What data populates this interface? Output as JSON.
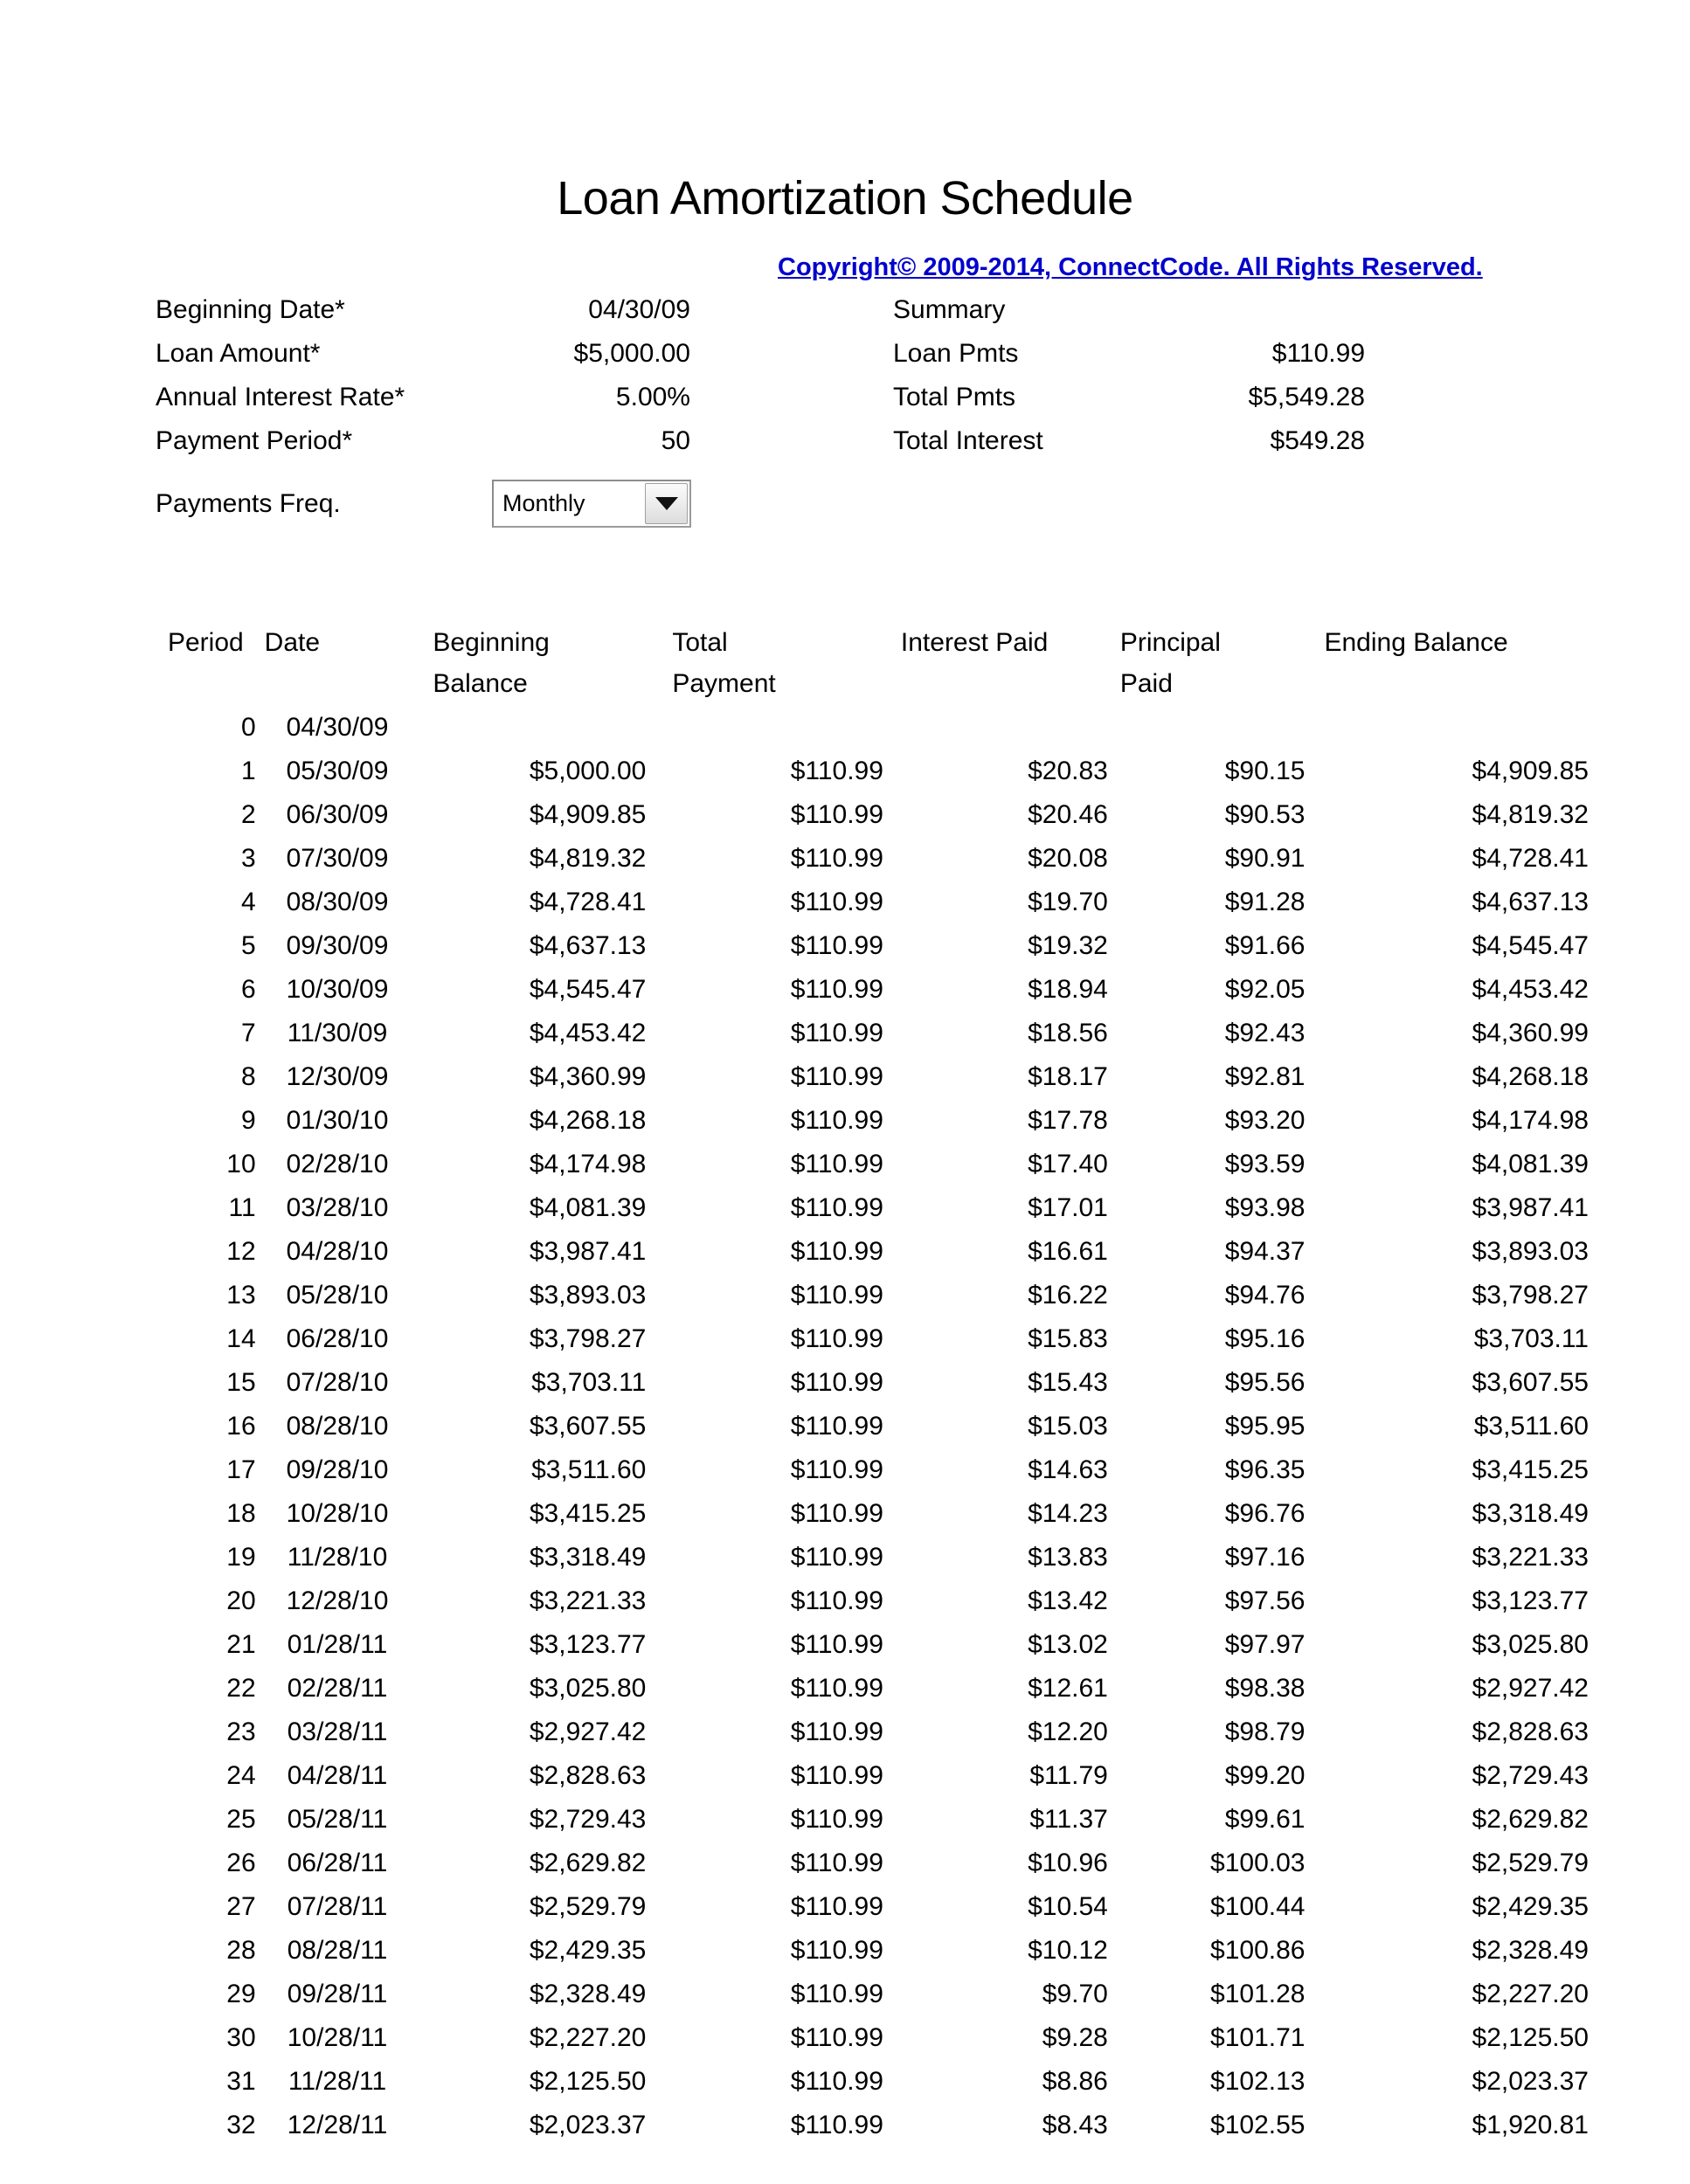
{
  "title": "Loan Amortization Schedule",
  "copyright": "Copyright© 2009-2014, ConnectCode. All Rights Reserved.",
  "colors": {
    "link": "#0000CC",
    "text": "#000000",
    "background": "#FFFFFF"
  },
  "inputs": {
    "rows": [
      {
        "label": "Beginning Date*",
        "value": "04/30/09"
      },
      {
        "label": "Loan Amount*",
        "value": "$5,000.00"
      },
      {
        "label": "Annual Interest Rate*",
        "value": "5.00%"
      },
      {
        "label": "Payment Period*",
        "value": "50"
      }
    ],
    "frequency": {
      "label": "Payments Freq.",
      "selected": "Monthly"
    }
  },
  "summary": {
    "heading": "Summary",
    "rows": [
      {
        "label": "Loan Pmts",
        "value": "$110.99"
      },
      {
        "label": "Total Pmts",
        "value": "$5,549.28"
      },
      {
        "label": "Total Interest",
        "value": "$549.28"
      }
    ]
  },
  "schedule": {
    "headers": [
      {
        "line1": "Period",
        "line2": ""
      },
      {
        "line1": "Date",
        "line2": ""
      },
      {
        "line1": "Beginning",
        "line2": "Balance"
      },
      {
        "line1": "Total",
        "line2": "Payment"
      },
      {
        "line1": "Interest Paid",
        "line2": ""
      },
      {
        "line1": "Principal",
        "line2": "Paid"
      },
      {
        "line1": "Ending Balance",
        "line2": ""
      }
    ],
    "rows": [
      {
        "period": "0",
        "date": "04/30/09",
        "beginning": "",
        "payment": "",
        "interest": "",
        "principal": "",
        "ending": ""
      },
      {
        "period": "1",
        "date": "05/30/09",
        "beginning": "$5,000.00",
        "payment": "$110.99",
        "interest": "$20.83",
        "principal": "$90.15",
        "ending": "$4,909.85"
      },
      {
        "period": "2",
        "date": "06/30/09",
        "beginning": "$4,909.85",
        "payment": "$110.99",
        "interest": "$20.46",
        "principal": "$90.53",
        "ending": "$4,819.32"
      },
      {
        "period": "3",
        "date": "07/30/09",
        "beginning": "$4,819.32",
        "payment": "$110.99",
        "interest": "$20.08",
        "principal": "$90.91",
        "ending": "$4,728.41"
      },
      {
        "period": "4",
        "date": "08/30/09",
        "beginning": "$4,728.41",
        "payment": "$110.99",
        "interest": "$19.70",
        "principal": "$91.28",
        "ending": "$4,637.13"
      },
      {
        "period": "5",
        "date": "09/30/09",
        "beginning": "$4,637.13",
        "payment": "$110.99",
        "interest": "$19.32",
        "principal": "$91.66",
        "ending": "$4,545.47"
      },
      {
        "period": "6",
        "date": "10/30/09",
        "beginning": "$4,545.47",
        "payment": "$110.99",
        "interest": "$18.94",
        "principal": "$92.05",
        "ending": "$4,453.42"
      },
      {
        "period": "7",
        "date": "11/30/09",
        "beginning": "$4,453.42",
        "payment": "$110.99",
        "interest": "$18.56",
        "principal": "$92.43",
        "ending": "$4,360.99"
      },
      {
        "period": "8",
        "date": "12/30/09",
        "beginning": "$4,360.99",
        "payment": "$110.99",
        "interest": "$18.17",
        "principal": "$92.81",
        "ending": "$4,268.18"
      },
      {
        "period": "9",
        "date": "01/30/10",
        "beginning": "$4,268.18",
        "payment": "$110.99",
        "interest": "$17.78",
        "principal": "$93.20",
        "ending": "$4,174.98"
      },
      {
        "period": "10",
        "date": "02/28/10",
        "beginning": "$4,174.98",
        "payment": "$110.99",
        "interest": "$17.40",
        "principal": "$93.59",
        "ending": "$4,081.39"
      },
      {
        "period": "11",
        "date": "03/28/10",
        "beginning": "$4,081.39",
        "payment": "$110.99",
        "interest": "$17.01",
        "principal": "$93.98",
        "ending": "$3,987.41"
      },
      {
        "period": "12",
        "date": "04/28/10",
        "beginning": "$3,987.41",
        "payment": "$110.99",
        "interest": "$16.61",
        "principal": "$94.37",
        "ending": "$3,893.03"
      },
      {
        "period": "13",
        "date": "05/28/10",
        "beginning": "$3,893.03",
        "payment": "$110.99",
        "interest": "$16.22",
        "principal": "$94.76",
        "ending": "$3,798.27"
      },
      {
        "period": "14",
        "date": "06/28/10",
        "beginning": "$3,798.27",
        "payment": "$110.99",
        "interest": "$15.83",
        "principal": "$95.16",
        "ending": "$3,703.11"
      },
      {
        "period": "15",
        "date": "07/28/10",
        "beginning": "$3,703.11",
        "payment": "$110.99",
        "interest": "$15.43",
        "principal": "$95.56",
        "ending": "$3,607.55"
      },
      {
        "period": "16",
        "date": "08/28/10",
        "beginning": "$3,607.55",
        "payment": "$110.99",
        "interest": "$15.03",
        "principal": "$95.95",
        "ending": "$3,511.60"
      },
      {
        "period": "17",
        "date": "09/28/10",
        "beginning": "$3,511.60",
        "payment": "$110.99",
        "interest": "$14.63",
        "principal": "$96.35",
        "ending": "$3,415.25"
      },
      {
        "period": "18",
        "date": "10/28/10",
        "beginning": "$3,415.25",
        "payment": "$110.99",
        "interest": "$14.23",
        "principal": "$96.76",
        "ending": "$3,318.49"
      },
      {
        "period": "19",
        "date": "11/28/10",
        "beginning": "$3,318.49",
        "payment": "$110.99",
        "interest": "$13.83",
        "principal": "$97.16",
        "ending": "$3,221.33"
      },
      {
        "period": "20",
        "date": "12/28/10",
        "beginning": "$3,221.33",
        "payment": "$110.99",
        "interest": "$13.42",
        "principal": "$97.56",
        "ending": "$3,123.77"
      },
      {
        "period": "21",
        "date": "01/28/11",
        "beginning": "$3,123.77",
        "payment": "$110.99",
        "interest": "$13.02",
        "principal": "$97.97",
        "ending": "$3,025.80"
      },
      {
        "period": "22",
        "date": "02/28/11",
        "beginning": "$3,025.80",
        "payment": "$110.99",
        "interest": "$12.61",
        "principal": "$98.38",
        "ending": "$2,927.42"
      },
      {
        "period": "23",
        "date": "03/28/11",
        "beginning": "$2,927.42",
        "payment": "$110.99",
        "interest": "$12.20",
        "principal": "$98.79",
        "ending": "$2,828.63"
      },
      {
        "period": "24",
        "date": "04/28/11",
        "beginning": "$2,828.63",
        "payment": "$110.99",
        "interest": "$11.79",
        "principal": "$99.20",
        "ending": "$2,729.43"
      },
      {
        "period": "25",
        "date": "05/28/11",
        "beginning": "$2,729.43",
        "payment": "$110.99",
        "interest": "$11.37",
        "principal": "$99.61",
        "ending": "$2,629.82"
      },
      {
        "period": "26",
        "date": "06/28/11",
        "beginning": "$2,629.82",
        "payment": "$110.99",
        "interest": "$10.96",
        "principal": "$100.03",
        "ending": "$2,529.79"
      },
      {
        "period": "27",
        "date": "07/28/11",
        "beginning": "$2,529.79",
        "payment": "$110.99",
        "interest": "$10.54",
        "principal": "$100.44",
        "ending": "$2,429.35"
      },
      {
        "period": "28",
        "date": "08/28/11",
        "beginning": "$2,429.35",
        "payment": "$110.99",
        "interest": "$10.12",
        "principal": "$100.86",
        "ending": "$2,328.49"
      },
      {
        "period": "29",
        "date": "09/28/11",
        "beginning": "$2,328.49",
        "payment": "$110.99",
        "interest": "$9.70",
        "principal": "$101.28",
        "ending": "$2,227.20"
      },
      {
        "period": "30",
        "date": "10/28/11",
        "beginning": "$2,227.20",
        "payment": "$110.99",
        "interest": "$9.28",
        "principal": "$101.71",
        "ending": "$2,125.50"
      },
      {
        "period": "31",
        "date": "11/28/11",
        "beginning": "$2,125.50",
        "payment": "$110.99",
        "interest": "$8.86",
        "principal": "$102.13",
        "ending": "$2,023.37"
      },
      {
        "period": "32",
        "date": "12/28/11",
        "beginning": "$2,023.37",
        "payment": "$110.99",
        "interest": "$8.43",
        "principal": "$102.55",
        "ending": "$1,920.81"
      }
    ]
  }
}
